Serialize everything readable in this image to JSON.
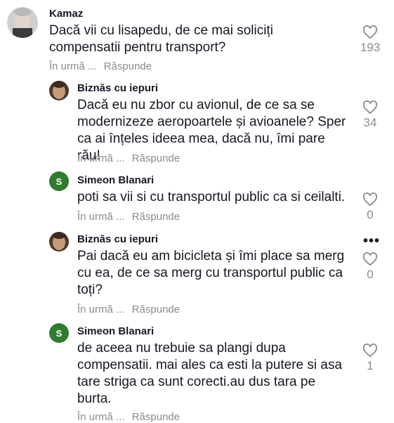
{
  "comments": [
    {
      "author": "Kamaz",
      "text": "Dacă vii cu lisapedu, de ce mai soliciți compensatii pentru transport?",
      "time": "În urmă ...",
      "reply": "Răspunde",
      "likes": "193"
    },
    {
      "author": "Biznăs cu iepuri",
      "text": "Dacă eu nu zbor cu avionul, de ce sa se modernizeze aeropoartele și avioanele? Sper ca ai înțeles ideea mea, dacă nu, îmi pare rău!",
      "time": "În urmă ...",
      "reply": "Răspunde",
      "likes": "34"
    },
    {
      "author": "Simeon Blanari",
      "avatar_letter": "S",
      "text": "poti sa vii si cu transportul public ca si ceilalti.",
      "time": "În urmă ...",
      "reply": "Răspunde",
      "likes": "0"
    },
    {
      "author": "Biznăs cu iepuri",
      "text": "Pai dacă eu am bicicleta și îmi place sa merg cu ea, de ce sa merg cu transportul public ca toți?",
      "time": "În urmă ...",
      "reply": "Răspunde",
      "likes": "0",
      "more": "•••"
    },
    {
      "author": "Simeon Blanari",
      "avatar_letter": "S",
      "text": "de aceea nu trebuie sa plangi dupa compensatii. mai ales ca esti la putere si asa tare striga ca sunt corecti.au dus tara pe burta.",
      "time": "În urmă ...",
      "reply": "Răspunde",
      "likes": "1"
    }
  ],
  "colors": {
    "accent_avatar": "#2e7d2e",
    "muted": "#8a8b91",
    "text": "#161823"
  },
  "icons": {
    "like": "heart-outline-icon",
    "more": "more-horizontal-icon"
  }
}
